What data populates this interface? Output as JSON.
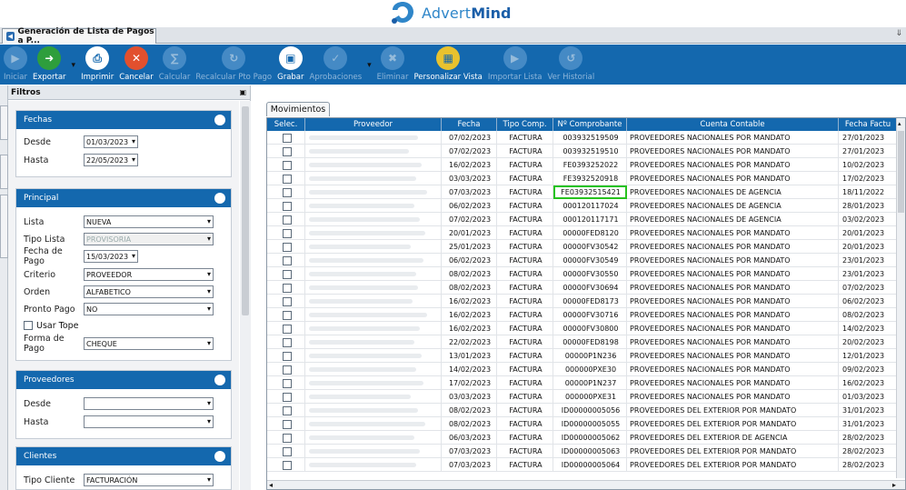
{
  "brand": {
    "logo_text_1": "Advert",
    "logo_text_2": "Mind"
  },
  "document_tab": {
    "title": "Generación de Lista de Pagos a P..."
  },
  "toolbar": {
    "buttons": [
      {
        "label": "Iniciar",
        "enabled": false,
        "icon": "play-icon",
        "color": "#6ea6d9"
      },
      {
        "label": "Exportar",
        "enabled": true,
        "icon": "export-icon",
        "color": "#2e9e3c",
        "caret": true
      },
      {
        "label": "Imprimir",
        "enabled": true,
        "icon": "printer-icon",
        "color": "#ffffff"
      },
      {
        "label": "Cancelar",
        "enabled": true,
        "icon": "cancel-icon",
        "color": "#e2502e"
      },
      {
        "label": "Calcular",
        "enabled": false,
        "icon": "calculate-icon",
        "color": "#6ea6d9"
      },
      {
        "label": "Recalcular Pto Pago",
        "enabled": false,
        "icon": "recalculate-icon",
        "color": "#6ea6d9"
      },
      {
        "label": "Grabar",
        "enabled": true,
        "icon": "save-icon",
        "color": "#ffffff"
      },
      {
        "label": "Aprobaciones",
        "enabled": false,
        "icon": "approvals-icon",
        "color": "#6ea6d9",
        "caret": true
      },
      {
        "label": "Eliminar",
        "enabled": false,
        "icon": "delete-icon",
        "color": "#6ea6d9"
      },
      {
        "label": "Personalizar Vista",
        "enabled": true,
        "icon": "customize-view-icon",
        "color": "#e8c22e"
      },
      {
        "label": "Importar Lista",
        "enabled": false,
        "icon": "import-icon",
        "color": "#6ea6d9"
      },
      {
        "label": "Ver Historial",
        "enabled": false,
        "icon": "history-icon",
        "color": "#6ea6d9"
      }
    ]
  },
  "filters": {
    "title": "Filtros",
    "fechas": {
      "title": "Fechas",
      "desde_label": "Desde",
      "desde": "01/03/2023",
      "hasta_label": "Hasta",
      "hasta": "22/05/2023"
    },
    "principal": {
      "title": "Principal",
      "lista_label": "Lista",
      "lista": "NUEVA",
      "tipo_lista_label": "Tipo Lista",
      "tipo_lista": "PROVISORIA",
      "fecha_pago_label": "Fecha de Pago",
      "fecha_pago": "15/03/2023",
      "criterio_label": "Criterio",
      "criterio": "PROVEEDOR",
      "orden_label": "Orden",
      "orden": "ALFABETICO",
      "pronto_pago_label": "Pronto Pago",
      "pronto_pago": "NO",
      "usar_tope_label": "Usar Tope",
      "forma_pago_label": "Forma de Pago",
      "forma_pago": "CHEQUE"
    },
    "proveedores": {
      "title": "Proveedores",
      "desde_label": "Desde",
      "desde": "",
      "hasta_label": "Hasta",
      "hasta": ""
    },
    "clientes": {
      "title": "Clientes",
      "tipo_cliente_label": "Tipo Cliente",
      "tipo_cliente": "FACTURACIÓN"
    }
  },
  "movimientos": {
    "tab_label": "Movimientos",
    "columns": [
      "Selec.",
      "Proveedor",
      "Fecha",
      "Tipo Comp.",
      "Nº Comprobante",
      "Cuenta Contable",
      "Fecha Factu"
    ],
    "rows": [
      [
        "",
        "07/02/2023",
        "FACTURA",
        "003932519509",
        "PROVEEDORES NACIONALES POR MANDATO",
        "27/01/2023"
      ],
      [
        "",
        "07/02/2023",
        "FACTURA",
        "003932519510",
        "PROVEEDORES NACIONALES POR MANDATO",
        "27/01/2023"
      ],
      [
        "",
        "16/02/2023",
        "FACTURA",
        "FE0393252022",
        "PROVEEDORES NACIONALES POR MANDATO",
        "10/02/2023"
      ],
      [
        "",
        "03/03/2023",
        "FACTURA",
        "FE3932520918",
        "PROVEEDORES NACIONALES POR MANDATO",
        "17/02/2023"
      ],
      [
        "",
        "07/03/2023",
        "FACTURA",
        "FE03932515421",
        "PROVEEDORES NACIONALES DE AGENCIA",
        "18/11/2022"
      ],
      [
        "",
        "06/02/2023",
        "FACTURA",
        "000120117024",
        "PROVEEDORES NACIONALES DE AGENCIA",
        "28/01/2023"
      ],
      [
        "",
        "07/02/2023",
        "FACTURA",
        "000120117171",
        "PROVEEDORES NACIONALES DE AGENCIA",
        "03/02/2023"
      ],
      [
        "",
        "20/01/2023",
        "FACTURA",
        "00000FED8120",
        "PROVEEDORES NACIONALES POR MANDATO",
        "20/01/2023"
      ],
      [
        "",
        "25/01/2023",
        "FACTURA",
        "00000FV30542",
        "PROVEEDORES NACIONALES POR MANDATO",
        "20/01/2023"
      ],
      [
        "",
        "06/02/2023",
        "FACTURA",
        "00000FV30549",
        "PROVEEDORES NACIONALES POR MANDATO",
        "23/01/2023"
      ],
      [
        "",
        "08/02/2023",
        "FACTURA",
        "00000FV30550",
        "PROVEEDORES NACIONALES POR MANDATO",
        "23/01/2023"
      ],
      [
        "",
        "08/02/2023",
        "FACTURA",
        "00000FV30694",
        "PROVEEDORES NACIONALES POR MANDATO",
        "07/02/2023"
      ],
      [
        "",
        "16/02/2023",
        "FACTURA",
        "00000FED8173",
        "PROVEEDORES NACIONALES POR MANDATO",
        "06/02/2023"
      ],
      [
        "",
        "16/02/2023",
        "FACTURA",
        "00000FV30716",
        "PROVEEDORES NACIONALES POR MANDATO",
        "08/02/2023"
      ],
      [
        "",
        "16/02/2023",
        "FACTURA",
        "00000FV30800",
        "PROVEEDORES NACIONALES POR MANDATO",
        "14/02/2023"
      ],
      [
        "",
        "22/02/2023",
        "FACTURA",
        "00000FED8198",
        "PROVEEDORES NACIONALES POR MANDATO",
        "20/02/2023"
      ],
      [
        "",
        "13/01/2023",
        "FACTURA",
        "00000P1N236",
        "PROVEEDORES NACIONALES POR MANDATO",
        "12/01/2023"
      ],
      [
        "",
        "14/02/2023",
        "FACTURA",
        "000000PXE30",
        "PROVEEDORES NACIONALES POR MANDATO",
        "09/02/2023"
      ],
      [
        "",
        "17/02/2023",
        "FACTURA",
        "00000P1N237",
        "PROVEEDORES NACIONALES POR MANDATO",
        "16/02/2023"
      ],
      [
        "",
        "03/03/2023",
        "FACTURA",
        "000000PXE31",
        "PROVEEDORES NACIONALES POR MANDATO",
        "01/03/2023"
      ],
      [
        "",
        "08/02/2023",
        "FACTURA",
        "ID00000005056",
        "PROVEEDORES DEL EXTERIOR POR MANDATO",
        "31/01/2023"
      ],
      [
        "",
        "08/02/2023",
        "FACTURA",
        "ID00000005055",
        "PROVEEDORES DEL EXTERIOR POR MANDATO",
        "31/01/2023"
      ],
      [
        "",
        "06/03/2023",
        "FACTURA",
        "ID00000005062",
        "PROVEEDORES DEL EXTERIOR DE AGENCIA",
        "28/02/2023"
      ],
      [
        "",
        "07/03/2023",
        "FACTURA",
        "ID00000005063",
        "PROVEEDORES DEL EXTERIOR POR MANDATO",
        "28/02/2023"
      ],
      [
        "",
        "07/03/2023",
        "FACTURA",
        "ID00000005064",
        "PROVEEDORES DEL EXTERIOR POR MANDATO",
        "28/02/2023"
      ]
    ],
    "highlighted_row": 4,
    "highlight_color": "#27c21e"
  },
  "colors": {
    "accent": "#1468ae"
  }
}
